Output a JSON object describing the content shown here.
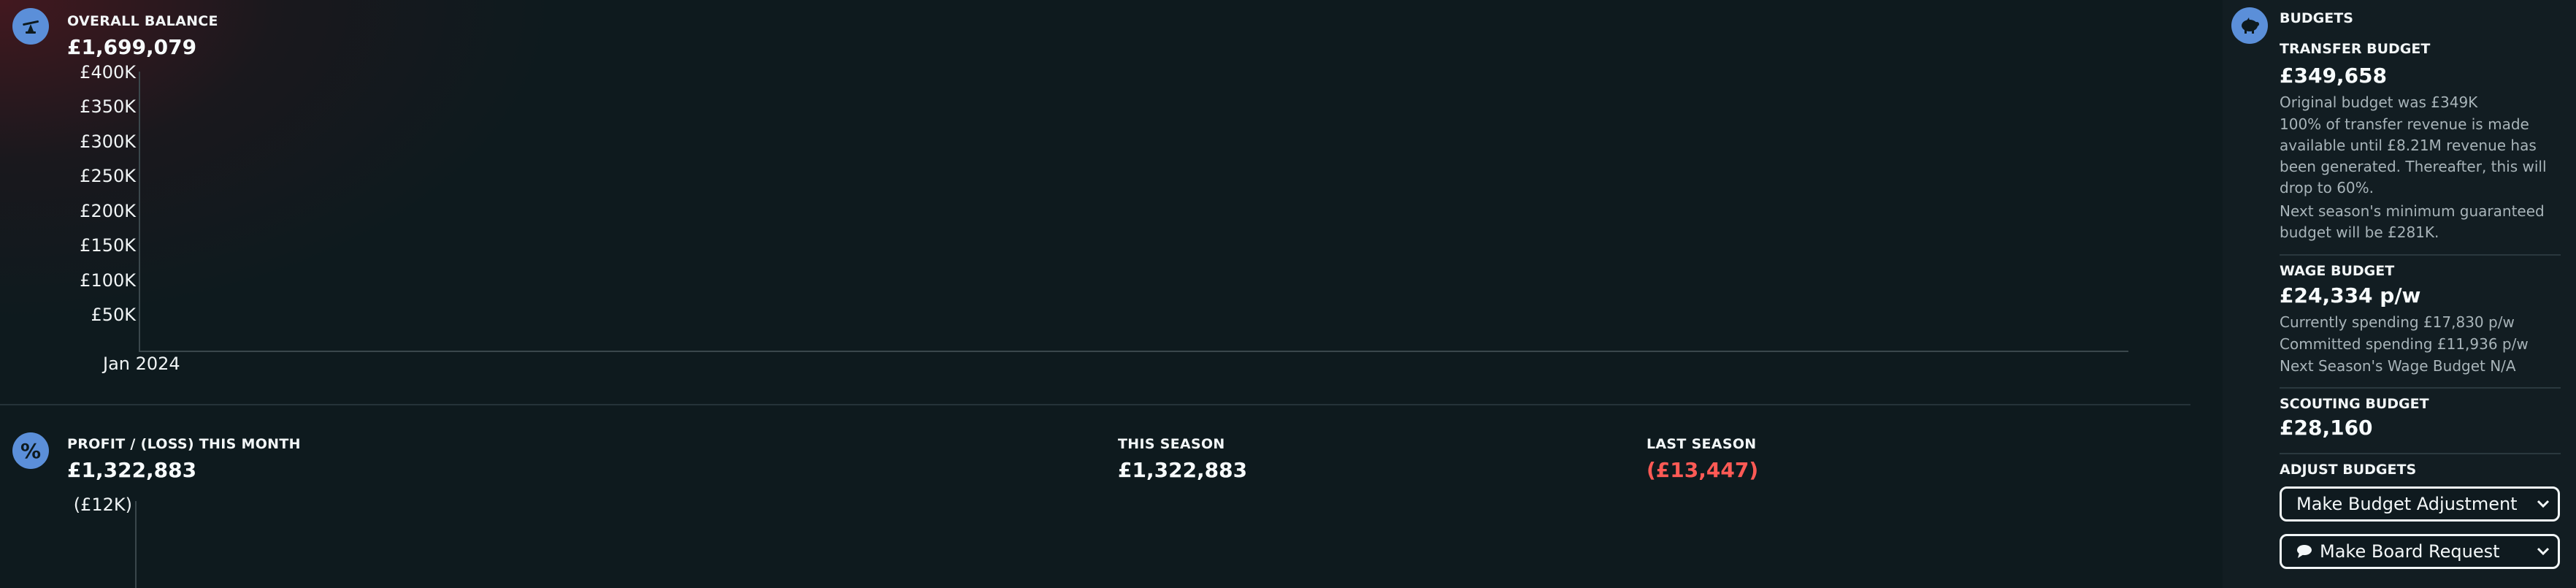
{
  "overall_balance": {
    "label": "OVERALL BALANCE",
    "value": "£1,699,079",
    "icon": "scales-icon"
  },
  "chart_data": [
    {
      "type": "line",
      "title": "OVERALL BALANCE",
      "y_ticks": [
        "£400K",
        "£350K",
        "£300K",
        "£250K",
        "£200K",
        "£150K",
        "£100K",
        "£50K"
      ],
      "x_ticks": [
        "Jan 2024"
      ],
      "series": []
    },
    {
      "type": "bar",
      "title": "PROFIT / (LOSS) THIS MONTH",
      "y_ticks": [
        "(£12K)"
      ],
      "series": []
    }
  ],
  "profit_loss": {
    "label": "PROFIT / (LOSS) THIS MONTH",
    "value": "£1,322,883",
    "icon": "percent-icon",
    "this_season_label": "THIS SEASON",
    "this_season_value": "£1,322,883",
    "last_season_label": "LAST SEASON",
    "last_season_value": "(£13,447)",
    "negative_color": "#ff5a55"
  },
  "budgets": {
    "title": "BUDGETS",
    "icon": "piggy-bank-icon",
    "transfer": {
      "label": "TRANSFER BUDGET",
      "value": "£349,658",
      "lines": [
        "Original budget was £349K",
        "100% of transfer revenue is made available until £8.21M revenue has been generated. Thereafter, this will drop to 60%.",
        "Next season's minimum guaranteed budget will be £281K."
      ]
    },
    "wage": {
      "label": "WAGE BUDGET",
      "value": "£24,334 p/w",
      "lines": [
        "Currently spending £17,830 p/w",
        "Committed spending £11,936 p/w",
        "Next Season's Wage Budget N/A"
      ]
    },
    "scouting": {
      "label": "SCOUTING BUDGET",
      "value": "£28,160"
    },
    "adjust": {
      "label": "ADJUST BUDGETS",
      "adjustment_button": "Make Budget Adjustment",
      "board_button": "Make Board Request",
      "board_icon": "speech-bubble-icon"
    }
  },
  "colors": {
    "accent": "#5b8fd9",
    "background": "#0e1a1e",
    "sidebar": "#121d22"
  }
}
